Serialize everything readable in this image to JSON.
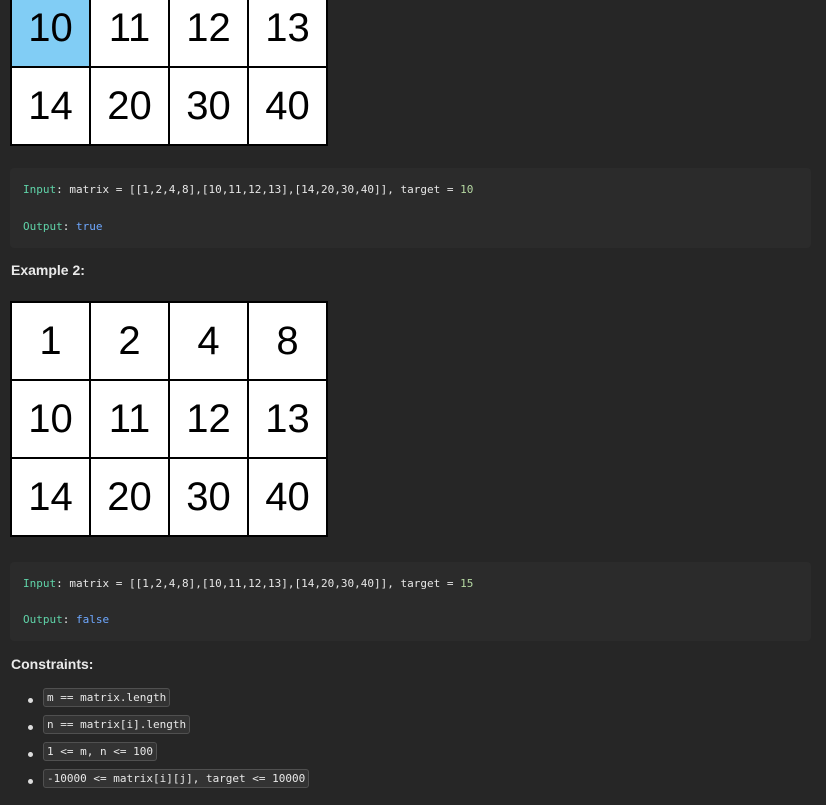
{
  "example1": {
    "matrix_tail": [
      [
        "10",
        "11",
        "12",
        "13"
      ],
      [
        "14",
        "20",
        "30",
        "40"
      ]
    ],
    "input_label": "Input",
    "input_text": ": matrix = [[1,2,4,8],[10,11,12,13],[14,20,30,40]], target = ",
    "target": "10",
    "output_label": "Output",
    "output_sep": ": ",
    "output_value": "true"
  },
  "example2": {
    "heading": "Example 2:",
    "matrix": [
      [
        "1",
        "2",
        "4",
        "8"
      ],
      [
        "10",
        "11",
        "12",
        "13"
      ],
      [
        "14",
        "20",
        "30",
        "40"
      ]
    ],
    "input_label": "Input",
    "input_text": ": matrix = [[1,2,4,8],[10,11,12,13],[14,20,30,40]], target = ",
    "target": "15",
    "output_label": "Output",
    "output_sep": ": ",
    "output_value": "false"
  },
  "constraints": {
    "heading": "Constraints:",
    "items": [
      "m == matrix.length",
      "n == matrix[i].length",
      "1 <= m, n <= 100",
      "-10000 <= matrix[i][j], target <= 10000"
    ]
  },
  "colors": {
    "highlight_cell": "#81cdf5",
    "keyword": "#5fd3a8",
    "bool": "#6ea8ff"
  }
}
